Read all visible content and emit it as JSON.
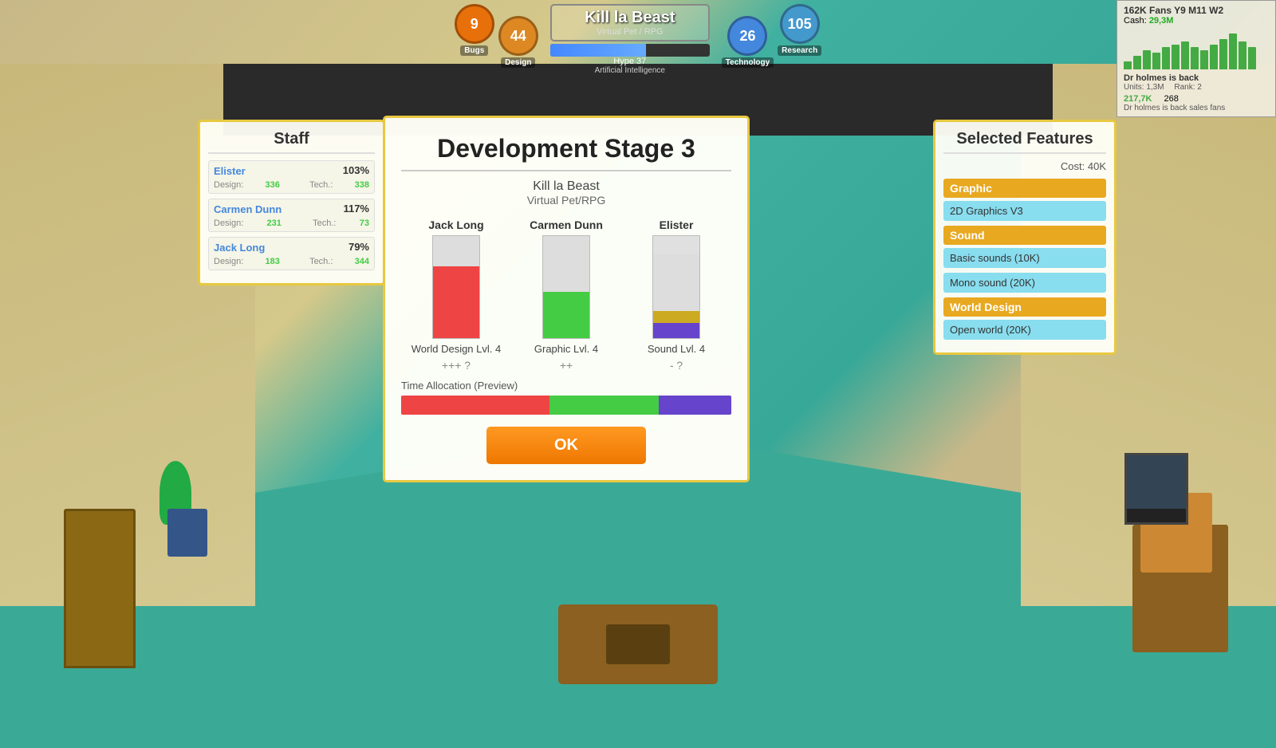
{
  "hud": {
    "bugs_count": "9",
    "bugs_label": "Bugs",
    "design_count": "44",
    "design_label": "Design",
    "game_title": "Kill la Beast",
    "game_genre": "Virtual Pet / RPG",
    "progress_label": "Artificial Intelligence",
    "hype_label": "Hype 37",
    "technology_count": "26",
    "technology_label": "Technology",
    "research_count": "105",
    "research_label": "Research"
  },
  "top_right": {
    "fans": "162K Fans Y9 M11 W2",
    "cash_label": "Cash:",
    "cash_value": "29,3M",
    "product_title": "Dr holmes is back",
    "units_label": "Units:",
    "units_value": "1,3M",
    "rank_label": "Rank:",
    "rank_value": "2",
    "product_name": "Dr holmes is back sales fans",
    "val1": "217,7K",
    "val2": "268"
  },
  "staff_panel": {
    "title": "Staff",
    "members": [
      {
        "name": "Elister",
        "pct": "103%",
        "design_label": "Design:",
        "design_val": "336",
        "tech_label": "Tech.:",
        "tech_val": "338"
      },
      {
        "name": "Carmen Dunn",
        "pct": "117%",
        "design_label": "Design:",
        "design_val": "231",
        "tech_label": "Tech.:",
        "tech_val": "73"
      },
      {
        "name": "Jack Long",
        "pct": "79%",
        "design_label": "Design:",
        "design_val": "183",
        "tech_label": "Tech.:",
        "tech_val": "344"
      }
    ]
  },
  "dialog": {
    "title": "Development Stage 3",
    "game_name": "Kill la Beast",
    "game_genre": "Virtual Pet/RPG",
    "contributors": [
      {
        "name": "Jack Long",
        "level": "World Design Lvl. 4",
        "score": "+++ ?",
        "bar_color": "#ee4444",
        "bar_height_pct": 70,
        "top_height_pct": 30
      },
      {
        "name": "Carmen Dunn",
        "level": "Graphic Lvl. 4",
        "score": "++",
        "bar_color": "#44cc44",
        "bar_height_pct": 45,
        "top_height_pct": 55
      },
      {
        "name": "Elister",
        "level": "Sound Lvl. 4",
        "score": "- ?",
        "bar_color": "#6644cc",
        "bar_height_pct": 25,
        "top_height_pct": 55,
        "has_yellow": true
      }
    ],
    "time_label": "Time Allocation (Preview)",
    "time_segments": [
      {
        "color": "#ee4444",
        "flex": 45
      },
      {
        "color": "#44cc44",
        "flex": 33
      },
      {
        "color": "#6644cc",
        "flex": 22
      }
    ],
    "ok_label": "OK"
  },
  "features_panel": {
    "title": "Selected Features",
    "cost_label": "Cost: 40K",
    "categories": [
      {
        "name": "Graphic",
        "items": [
          "2D Graphics V3"
        ]
      },
      {
        "name": "Sound",
        "items": [
          "Basic sounds (10K)",
          "Mono sound (20K)"
        ]
      },
      {
        "name": "World Design",
        "items": [
          "Open world (20K)"
        ]
      }
    ]
  },
  "chart_bars": [
    3,
    5,
    7,
    6,
    8,
    9,
    10,
    8,
    7,
    9,
    11,
    13,
    10,
    8
  ]
}
